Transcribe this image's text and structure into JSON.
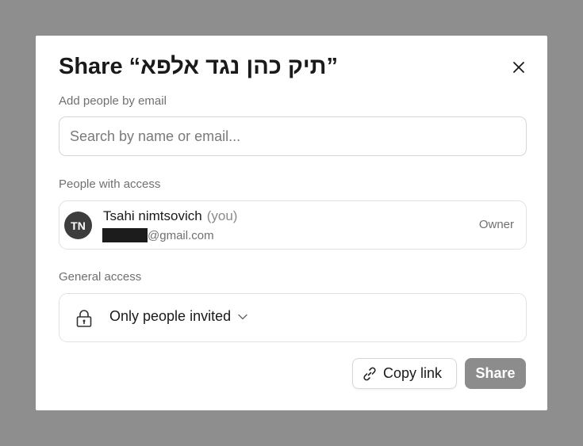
{
  "dialog": {
    "title": "Share “תיק כהן נגד אלפא”",
    "close_icon": "close-icon"
  },
  "add_people": {
    "label": "Add people by email",
    "placeholder": "Search by name or email...",
    "value": ""
  },
  "people_access": {
    "label": "People with access",
    "people": [
      {
        "initials": "TN",
        "name": "Tsahi nimtsovich",
        "you_tag": "(you)",
        "email_domain": "@gmail.com",
        "role": "Owner"
      }
    ]
  },
  "general_access": {
    "label": "General access",
    "icon": "lock-icon",
    "selected": "Only people invited"
  },
  "footer": {
    "copy_link_label": "Copy link",
    "copy_link_icon": "link-icon",
    "share_label": "Share"
  },
  "colors": {
    "overlay": "#8e8e8e",
    "avatar_bg": "#3d3d3d",
    "share_button_bg": "#8c8c8c"
  }
}
